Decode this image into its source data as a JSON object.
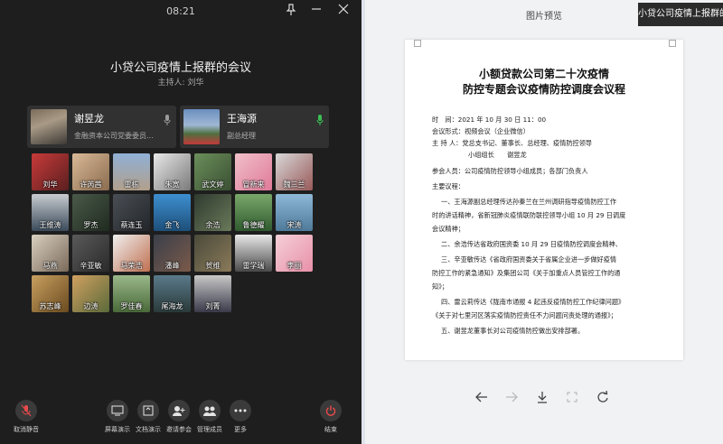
{
  "meeting": {
    "time": "08:21",
    "title": "小贷公司疫情上报群的会议",
    "host": "主持人: 刘华",
    "speakers": [
      {
        "name": "谢昱龙",
        "role": "金融资本公司党委委员..."
      },
      {
        "name": "王海源",
        "role": "副总经理"
      }
    ],
    "participants": [
      "刘华",
      "许芮茜",
      "雷栋",
      "朱宽",
      "武文婷",
      "冒新来",
      "魏三兰",
      "王维涛",
      "罗杰",
      "蔡连玉",
      "金飞",
      "余浩",
      "鲁德耀",
      "宋涛",
      "马燕",
      "辛亚敏",
      "马荣浩",
      "潘峰",
      "贺维",
      "雷学瑞",
      "李丽",
      "苏志峰",
      "边涛",
      "罗佳春",
      "尾海龙",
      "刘菁"
    ],
    "toolbar": [
      {
        "label": "取消静音",
        "icon": "mic-muted-icon"
      },
      {
        "label": "屏幕演示",
        "icon": "screen-share-icon"
      },
      {
        "label": "文档演示",
        "icon": "doc-share-icon"
      },
      {
        "label": "邀请参会",
        "icon": "invite-icon"
      },
      {
        "label": "管理成员",
        "icon": "members-icon"
      },
      {
        "label": "更多",
        "icon": "more-icon"
      },
      {
        "label": "结束",
        "icon": "power-icon"
      }
    ]
  },
  "preview": {
    "title": "图片预览",
    "tooltip": "小贷公司疫情上报群的",
    "document": {
      "title_line1": "小额贷款公司第二十次疫情",
      "title_line2": "防控专题会议疫情防控调度会议程",
      "lines": [
        "时　间：2021 年 10 月 30 日 11：00",
        "会议形式：视频会议（企业微信）",
        "主 持 人：党总支书记、董事长、总经理、疫情防控领导",
        "小组组长　　谢昱龙",
        "参会人员：公司疫情防控领导小组成员；各部门负责人",
        "主要议程：",
        "一、王海源副总经理传达孙秦兰在兰州调研指导疫情防控工作",
        "时的讲话精神，省新冠肺炎疫情联防联控领导小组 10 月 29 日调度",
        "会议精神；",
        "二、余浩传达省政府国资委 10 月 29 日疫情防控调度会精神、",
        "三、辛亚敏传达《省政府国资委关于省属企业进一步做好疫情",
        "防控工作的紧急通知》及集团公司《关于加重点人员管控工作的通",
        "知》；",
        "四、雷云莉传达《陇南市通报 4 起违反疫情防控工作纪律问题》",
        "《关于对七里河区落实疫情防控责任不力问题问责处理的通报》；",
        "五、谢昱龙董事长对公司疫情防控做出安排部署。"
      ]
    }
  }
}
